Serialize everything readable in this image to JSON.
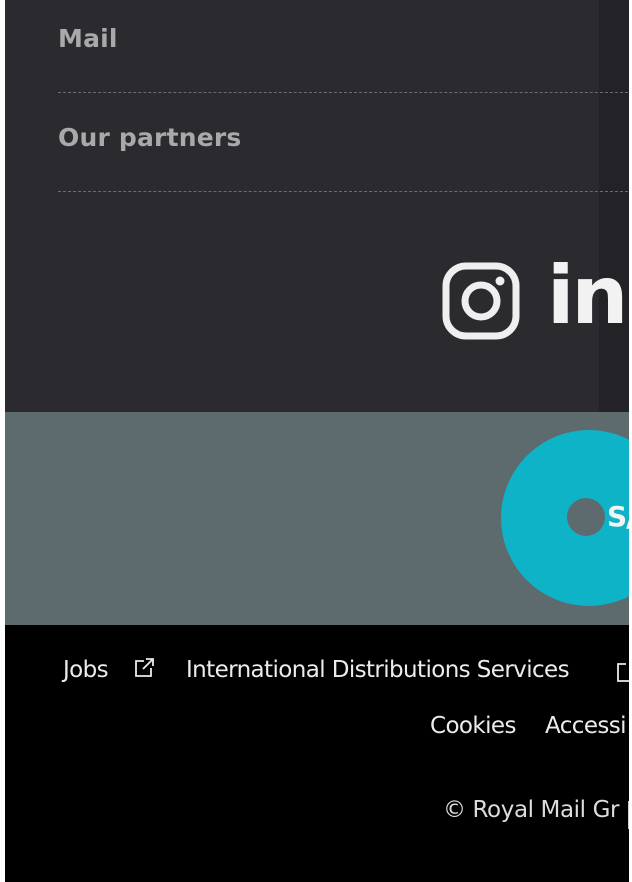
{
  "footer_nav": {
    "links": [
      {
        "label": "Mail"
      },
      {
        "label": "Our partners"
      }
    ]
  },
  "social": {
    "icons": [
      "instagram-icon",
      "linkedin-icon"
    ],
    "linkedin_text": "in"
  },
  "banner": {
    "badge_text": "S/",
    "badge_color": "#0fb3c7",
    "background_color": "#5d6a6e"
  },
  "legal": {
    "links": [
      {
        "label": "Jobs"
      },
      {
        "label": "International Distributions Services"
      },
      {
        "label": "Cookies"
      },
      {
        "label": "Accessi"
      }
    ],
    "copyright": "© Royal Mail Gr"
  },
  "colors": {
    "nav_background": "#2b2a2e",
    "nav_text": "#a9a9ab",
    "legal_background": "#000000",
    "legal_text": "#ececec"
  }
}
